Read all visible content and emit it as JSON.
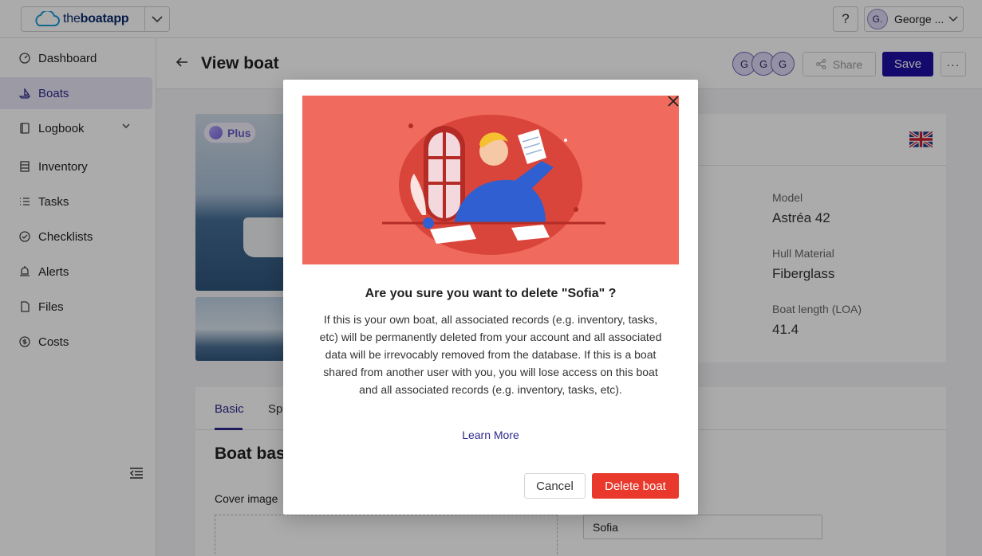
{
  "brand": {
    "prefix": "the",
    "name": "boatapp"
  },
  "topbar": {
    "help_label": "?",
    "user_initials": "G.",
    "user_name": "George ..."
  },
  "sidebar": {
    "items": [
      {
        "label": "Dashboard",
        "icon": "dashboard-icon"
      },
      {
        "label": "Boats",
        "icon": "boat-icon",
        "active": true
      },
      {
        "label": "Logbook",
        "icon": "book-icon"
      },
      {
        "label": "Inventory",
        "icon": "inventory-icon"
      },
      {
        "label": "Tasks",
        "icon": "tasks-icon"
      },
      {
        "label": "Checklists",
        "icon": "checklist-icon"
      },
      {
        "label": "Alerts",
        "icon": "bell-icon"
      },
      {
        "label": "Files",
        "icon": "file-icon"
      },
      {
        "label": "Costs",
        "icon": "dollar-icon"
      }
    ]
  },
  "page": {
    "title": "View boat",
    "collaborators": [
      "G",
      "G",
      "G"
    ],
    "share_label": "Share",
    "save_label": "Save",
    "more_label": "···"
  },
  "gallery": {
    "plan_badge": "Plus"
  },
  "specs": {
    "model_label": "Model",
    "model_value": "Astréa 42",
    "hull_label": "Hull Material",
    "hull_value": "Fiberglass",
    "length_label": "Boat length (LOA)",
    "length_value": "41.4"
  },
  "tabs": {
    "basic": "Basic",
    "second_partial": "Sp"
  },
  "form": {
    "section_title_partial": "Boat bas",
    "cover_label_partial": "Cover image",
    "name_value": "Sofia"
  },
  "modal": {
    "title": "Are you sure you want to delete \"Sofia\" ?",
    "body": "If this is your own boat, all associated records (e.g. inventory, tasks, etc) will be permanently deleted from your account and all associated data will be irrevocably removed from the database. If this is a boat shared from another user with you, you will lose access on this boat and all associated records (e.g. inventory, tasks, etc).",
    "learn_more": "Learn More",
    "cancel": "Cancel",
    "delete": "Delete boat"
  },
  "colors": {
    "primary": "#1f0fa3",
    "danger": "#e8392c",
    "illustration_bg": "#f06b5d"
  }
}
